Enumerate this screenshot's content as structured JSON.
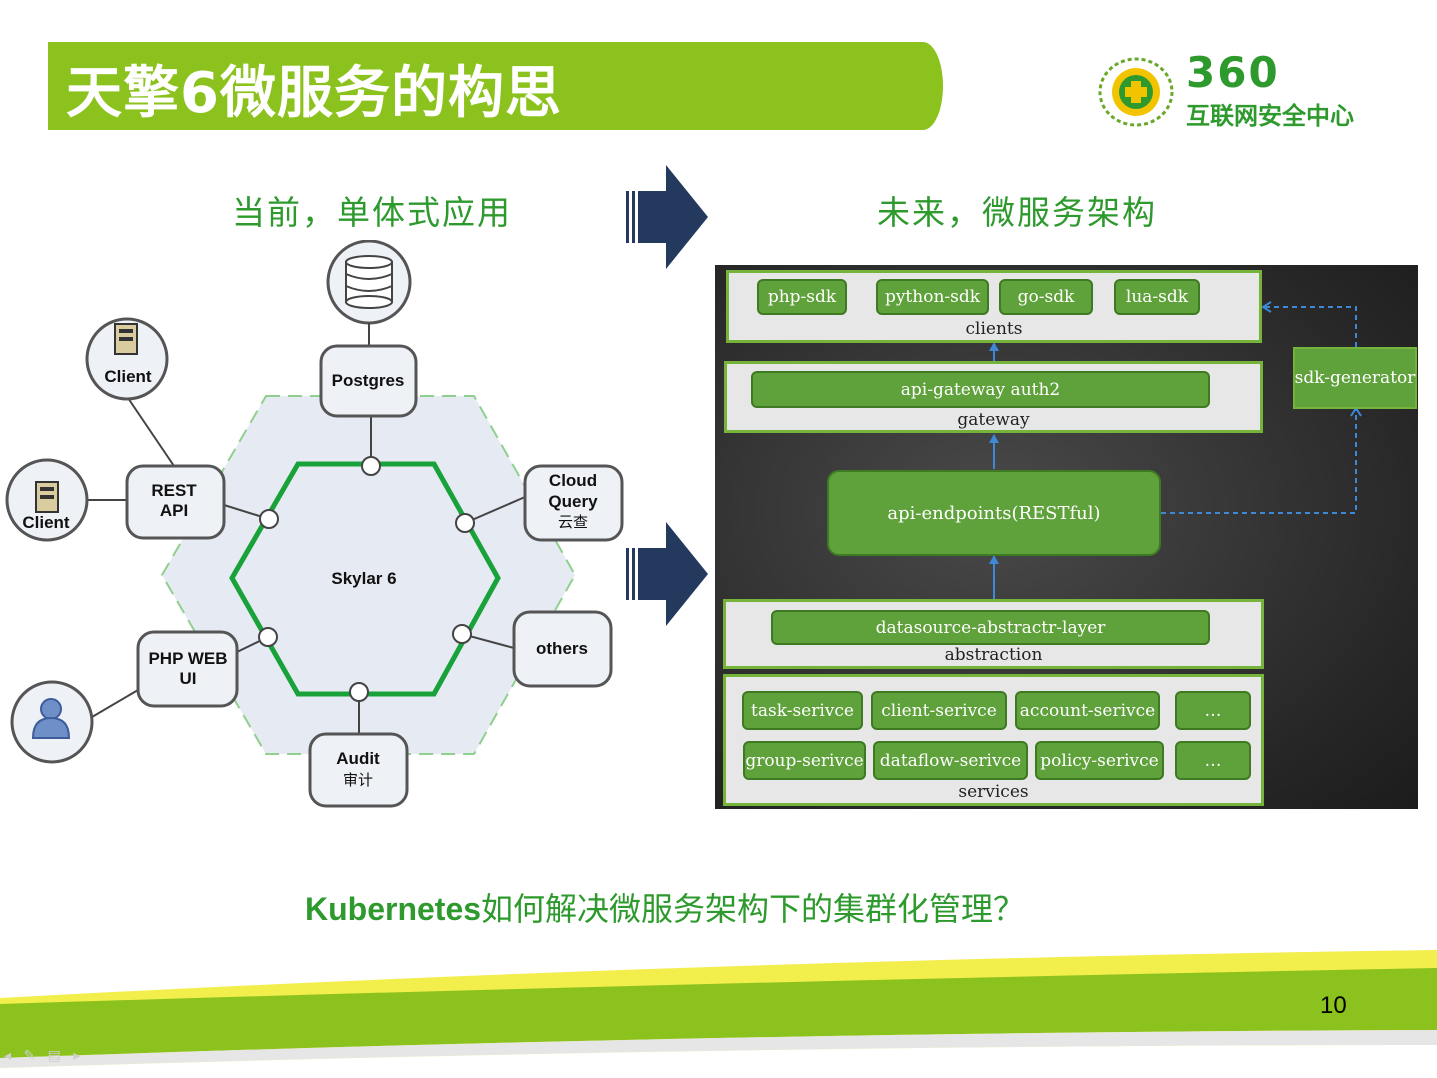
{
  "title": "天擎6微服务的构思",
  "logo": {
    "number": "360",
    "subtitle": "互联网安全中心"
  },
  "left_section_title": "当前，单体式应用",
  "right_section_title": "未来，微服务架构",
  "monolith": {
    "center": "Skylar 6",
    "nodes": {
      "postgres": "Postgres",
      "rest_api_l1": "REST",
      "rest_api_l2": "API",
      "cloud_query_l1": "Cloud",
      "cloud_query_l2": "Query",
      "cloud_query_l3": "云查",
      "php_web_l1": "PHP WEB",
      "php_web_l2": "UI",
      "others": "others",
      "audit_l1": "Audit",
      "audit_l2": "审计",
      "client_top": "Client",
      "client_left": "Client"
    }
  },
  "microservices": {
    "clients": {
      "label": "clients",
      "items": [
        "php-sdk",
        "python-sdk",
        "go-sdk",
        "lua-sdk"
      ]
    },
    "gateway": {
      "label": "gateway",
      "item": "api-gateway auth2"
    },
    "endpoints": "api-endpoints(RESTful)",
    "sdk_generator": "sdk-generator",
    "abstraction": {
      "label": "abstraction",
      "item": "datasource-abstractr-layer"
    },
    "services": {
      "label": "services",
      "row1": [
        "task-serivce",
        "client-serivce",
        "account-serivce",
        "…"
      ],
      "row2": [
        "group-serivce",
        "dataflow-serivce",
        "policy-serivce",
        "…"
      ]
    }
  },
  "question_prefix": "Kubernetes",
  "question_rest": "如何解决微服务架构下的集群化管理？",
  "page_number": "10",
  "colors": {
    "brand_green": "#8cc21d",
    "text_green": "#2e9a2e",
    "arrow_navy": "#233a5e",
    "hex_green": "#1aa23a"
  }
}
